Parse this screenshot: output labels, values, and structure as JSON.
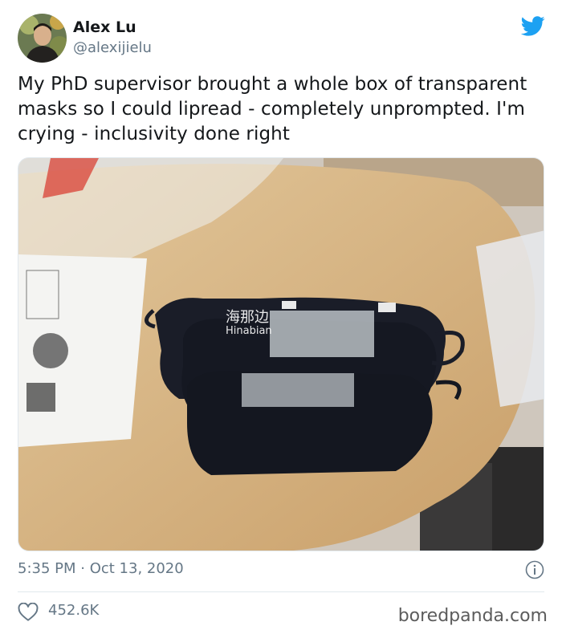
{
  "author": {
    "name": "Alex Lu",
    "handle": "@alexijielu"
  },
  "tweet": {
    "text": "My PhD supervisor brought a whole box of transparent masks so I could lipread - completely unprompted. I'm crying - inclusivity done right"
  },
  "photo": {
    "watermark_cn": "海那边",
    "watermark_en": "Hinabian"
  },
  "meta": {
    "timestamp": "5:35 PM · Oct 13, 2020",
    "likes": "452.6K"
  },
  "credit": "boredpanda.com",
  "icons": {
    "brand": "twitter-bird-icon",
    "info": "info-icon",
    "like": "heart-icon"
  },
  "colors": {
    "twitter_blue": "#1da1f2",
    "secondary_text": "#657786"
  }
}
